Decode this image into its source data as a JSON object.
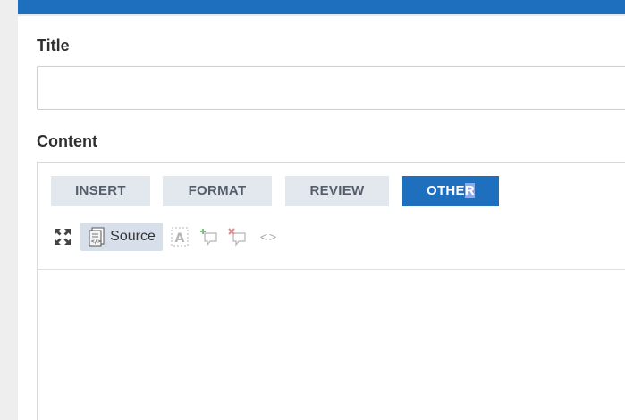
{
  "form": {
    "title_label": "Title",
    "title_value": "",
    "title_placeholder": "",
    "content_label": "Content"
  },
  "editor": {
    "tabs": [
      {
        "label": "INSERT",
        "active": false
      },
      {
        "label": "FORMAT",
        "active": false
      },
      {
        "label": "REVIEW",
        "active": false
      },
      {
        "label_before_selection": "OTHE",
        "label_selected": "R",
        "active": true
      }
    ],
    "tools": {
      "maximize_icon": "maximize-icon",
      "source_icon": "source-document-icon",
      "source_label": "Source",
      "anchor_icon": "anchor-a-icon",
      "comment_icon": "add-comment-icon",
      "comment_remove_icon": "remove-comment-icon",
      "code_label": "<>"
    }
  },
  "colors": {
    "accent": "#1f6fbf",
    "tab_inactive_bg": "#e3e8ef",
    "tab_inactive_text": "#555d68",
    "source_active_bg": "#d6dfea",
    "text_selection": "#8fa8e8"
  }
}
